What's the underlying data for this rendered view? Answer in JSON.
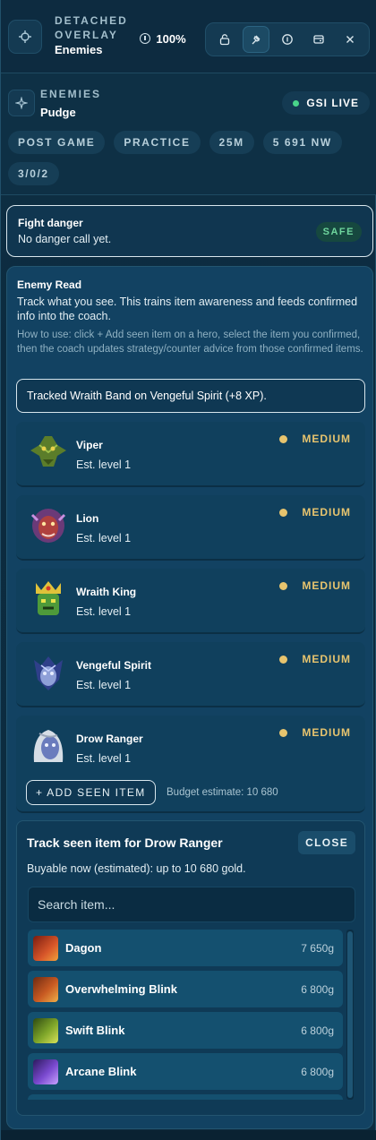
{
  "window": {
    "mode_line1": "DETACHED",
    "mode_line2": "OVERLAY",
    "panel_name": "Enemies",
    "zoom": "100%",
    "toolbar_icons": [
      "lock-icon",
      "pin-icon",
      "info-icon",
      "window-icon",
      "close-icon"
    ]
  },
  "header": {
    "section_label": "ENEMIES",
    "hero": "Pudge",
    "gsi": "GSI LIVE",
    "chips": [
      "POST GAME",
      "PRACTICE",
      "25M",
      "5 691 NW",
      "3/0/2"
    ]
  },
  "fight_danger": {
    "title": "Fight danger",
    "status": "No danger call yet.",
    "badge": "SAFE"
  },
  "enemy_read": {
    "title": "Enemy Read",
    "description": "Track what you see. This trains item awareness and feeds confirmed info into the coach.",
    "howto": "How to use: click + Add seen item on a hero, select the item you confirmed, then the coach updates strategy/counter advice from those confirmed items.",
    "toast": "Tracked Wraith Band on Vengeful Spirit (+8 XP).",
    "enemies": [
      {
        "name": "Viper",
        "level": "Est. level 1",
        "threat": "MEDIUM"
      },
      {
        "name": "Lion",
        "level": "Est. level 1",
        "threat": "MEDIUM"
      },
      {
        "name": "Wraith King",
        "level": "Est. level 1",
        "threat": "MEDIUM"
      },
      {
        "name": "Vengeful Spirit",
        "level": "Est. level 1",
        "threat": "MEDIUM"
      },
      {
        "name": "Drow Ranger",
        "level": "Est. level 1",
        "threat": "MEDIUM"
      }
    ],
    "add_seen_label": "+ ADD SEEN ITEM",
    "budget": "Budget estimate: 10 680"
  },
  "track_panel": {
    "title": "Track seen item for Drow Ranger",
    "close_label": "CLOSE",
    "buyable": "Buyable now (estimated): up to 10 680 gold.",
    "search_placeholder": "Search item...",
    "items": [
      {
        "name": "Dagon",
        "price": "7 650g"
      },
      {
        "name": "Overwhelming Blink",
        "price": "6 800g"
      },
      {
        "name": "Swift Blink",
        "price": "6 800g"
      },
      {
        "name": "Arcane Blink",
        "price": "6 800g"
      }
    ]
  },
  "colors": {
    "accent_medium": "#e7c46e",
    "safe_green": "#6fd69e",
    "gsi_dot": "#49d48a"
  }
}
